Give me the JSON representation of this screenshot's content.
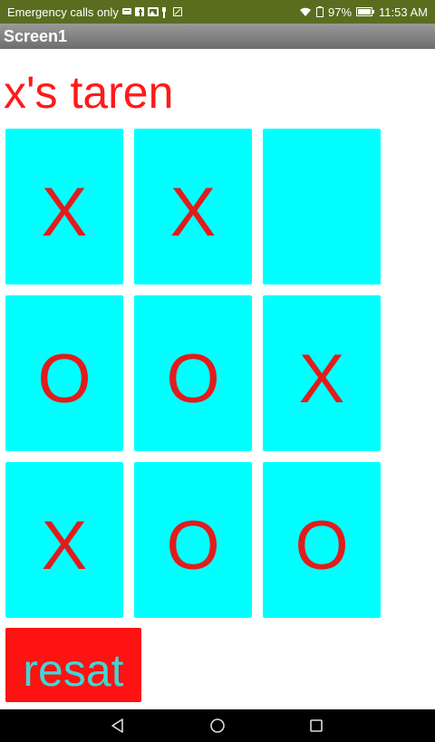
{
  "status_bar": {
    "carrier_text": "Emergency calls only",
    "battery_percent": "97%",
    "time": "11:53 AM",
    "background_color": "#5a6d1f",
    "left_icons": [
      "message-icon",
      "facebook-icon",
      "gallery-icon",
      "usb-icon",
      "screenshot-icon"
    ],
    "right_icons": [
      "wifi-icon",
      "battery-saver-icon",
      "battery-icon"
    ]
  },
  "title_bar": {
    "title": "Screen1"
  },
  "game": {
    "turn_text": "x's taren",
    "text_color": "#ff1a1a",
    "cell_color": "#00ffff",
    "mark_color": "#e31b1b",
    "board": [
      "X",
      "X",
      "",
      "O",
      "O",
      "X",
      "X",
      "O",
      "O"
    ]
  },
  "reset_button": {
    "label": "resat",
    "background_color": "#ff1212",
    "text_color": "#3fd6d6"
  },
  "nav_bar": {
    "buttons": [
      "back-icon",
      "home-icon",
      "recent-apps-icon"
    ]
  }
}
